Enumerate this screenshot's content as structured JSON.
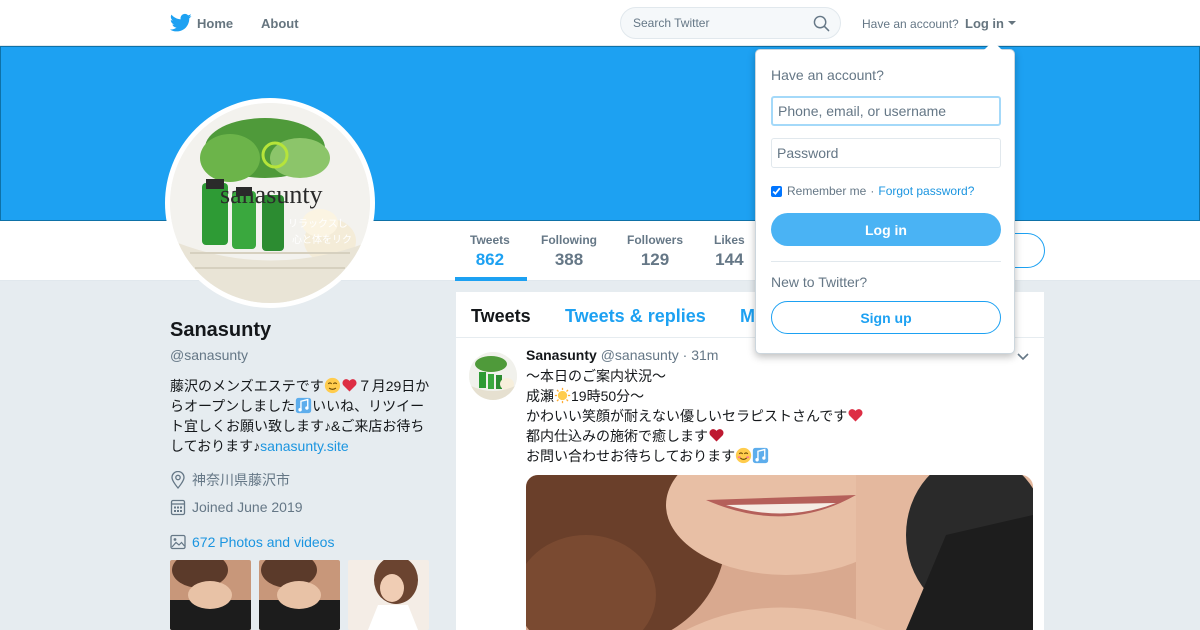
{
  "nav": {
    "home": "Home",
    "about": "About",
    "search_placeholder": "Search Twitter",
    "have_account": "Have an account?",
    "login": "Log in"
  },
  "profile": {
    "avatar_text": "sanasunty",
    "avatar_subtext_1": "リラックスし",
    "avatar_subtext_2": "心と体をリク",
    "name": "Sanasunty",
    "handle": "@sanasunty",
    "bio_1": "藤沢のメンズエステです",
    "bio_2": "７月29日からオープンしました",
    "bio_3": "いいね、リツイート宜しくお願い致します♪&ご来店お待ちしております♪",
    "bio_link": "sanasunty.site",
    "location": "神奈川県藤沢市",
    "joined": "Joined June 2019",
    "photos": "672 Photos and videos"
  },
  "stats": [
    {
      "label": "Tweets",
      "value": "862"
    },
    {
      "label": "Following",
      "value": "388"
    },
    {
      "label": "Followers",
      "value": "129"
    },
    {
      "label": "Likes",
      "value": "144"
    }
  ],
  "timeline": {
    "tabs": [
      "Tweets",
      "Tweets & replies",
      "M"
    ],
    "tweet": {
      "name": "Sanasunty",
      "handle": "@sanasunty",
      "time": "· 31m",
      "lines": [
        "～本日のご案内状況～",
        "成瀬",
        "19時50分～",
        "かわいい笑顔が耐えない優しいセラピストさんです",
        "都内仕込みの施術で癒します",
        "お問い合わせお待ちしております"
      ]
    }
  },
  "login_dropdown": {
    "title": "Have an account?",
    "username_placeholder": "Phone, email, or username",
    "password_placeholder": "Password",
    "remember": "Remember me",
    "separator": "·",
    "forgot": "Forgot password?",
    "login_button": "Log in",
    "new_to": "New to Twitter?",
    "signup_button": "Sign up"
  },
  "colors": {
    "brand_blue": "#1da1f2",
    "link_blue": "#1b95e0",
    "muted": "#657786",
    "background": "#e6ecf0"
  }
}
